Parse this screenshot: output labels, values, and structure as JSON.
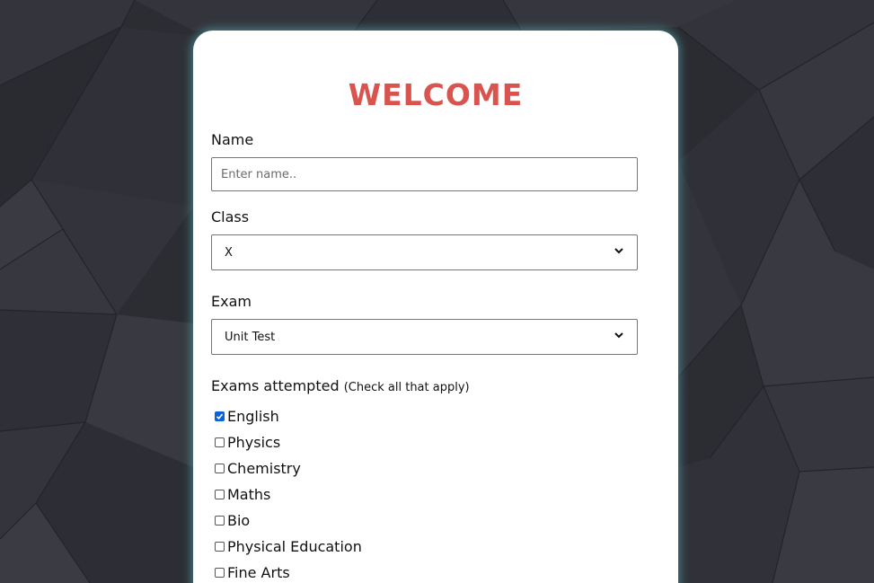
{
  "form": {
    "title": "WELCOME",
    "name": {
      "label": "Name",
      "placeholder": "Enter name..",
      "value": ""
    },
    "class": {
      "label": "Class",
      "selected": "X"
    },
    "exam": {
      "label": "Exam",
      "selected": "Unit Test"
    },
    "exams_attempted": {
      "label": "Exams attempted",
      "hint": "(Check all that apply)",
      "options": [
        {
          "label": "English",
          "checked": true
        },
        {
          "label": "Physics",
          "checked": false
        },
        {
          "label": "Chemistry",
          "checked": false
        },
        {
          "label": "Maths",
          "checked": false
        },
        {
          "label": "Bio",
          "checked": false
        },
        {
          "label": "Physical Education",
          "checked": false
        },
        {
          "label": "Fine Arts",
          "checked": false
        }
      ]
    }
  },
  "colors": {
    "background": "#2c2d33",
    "card": "#ffffff",
    "title": "#d9534f",
    "checkbox_checked": "#0b63d6",
    "card_glow": "#5abec8"
  },
  "icons": {
    "select_arrow": "chevron-down-icon",
    "check": "checkmark-icon"
  }
}
